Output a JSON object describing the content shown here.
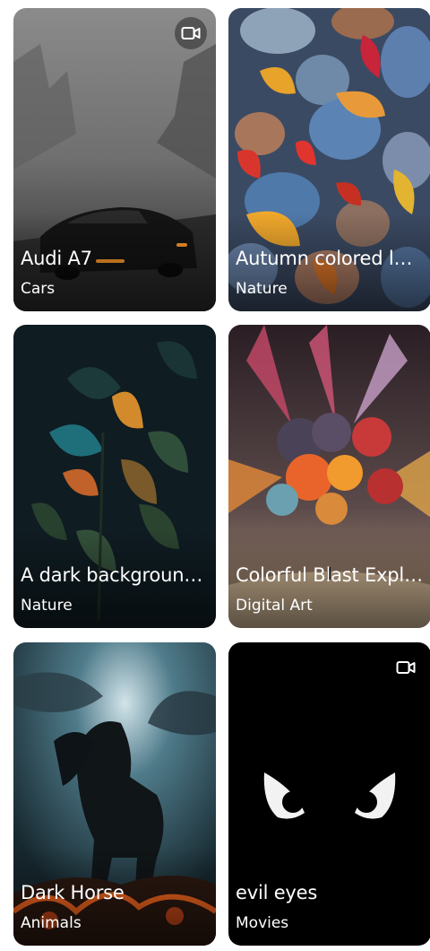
{
  "wallpapers": [
    {
      "title": "Audi A7",
      "category": "Cars",
      "is_video": true,
      "icon": "video-camera-icon"
    },
    {
      "title": "Autumn colored leaves on stones",
      "category": "Nature",
      "is_video": false
    },
    {
      "title": "A dark background with leaves",
      "category": "Nature",
      "is_video": false
    },
    {
      "title": "Colorful Blast Explosion",
      "category": "Digital Art",
      "is_video": false
    },
    {
      "title": "Dark Horse",
      "category": "Animals",
      "is_video": false
    },
    {
      "title": "evil eyes",
      "category": "Movies",
      "is_video": true,
      "icon": "video-camera-icon"
    }
  ],
  "colors": {
    "text": "#ffffff",
    "background": "#ffffff"
  }
}
